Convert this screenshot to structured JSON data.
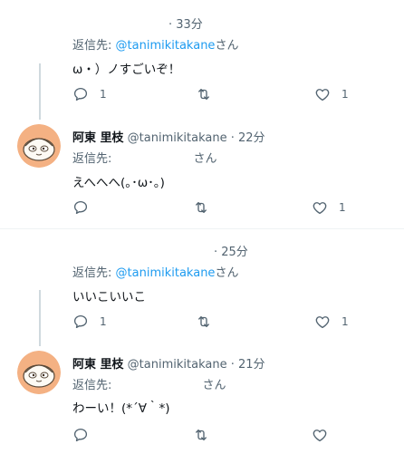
{
  "tweets": [
    {
      "time": "· 33分",
      "reply_label": "返信先:",
      "reply_handle": "@tanimikitakane",
      "reply_suffix": "さん",
      "text": "ω・）ノすごいぞ！",
      "replies": "1",
      "retweets": "",
      "likes": "1"
    },
    {
      "author_name": "阿東 里枝",
      "author_handle": "@tanimikitakane",
      "time": "· 22分",
      "reply_label": "返信先:",
      "reply_suffix": "さん",
      "text": "えへへへ(｡･ω･｡)",
      "replies": "",
      "retweets": "",
      "likes": "1"
    },
    {
      "time": "· 25分",
      "reply_label": "返信先:",
      "reply_handle": "@tanimikitakane",
      "reply_suffix": "さん",
      "text": "いいこいいこ",
      "replies": "1",
      "retweets": "",
      "likes": "1"
    },
    {
      "author_name": "阿東 里枝",
      "author_handle": "@tanimikitakane",
      "time": "· 21分",
      "reply_label": "返信先:",
      "reply_suffix": "さん",
      "text": "わーい！(*´∀｀*)",
      "replies": "",
      "retweets": "",
      "likes": ""
    }
  ],
  "icons": [
    "reply-icon",
    "retweet-icon",
    "like-icon"
  ],
  "colors": {
    "link": "#1d9bf0",
    "muted": "#536471",
    "thread_line": "#cfd9de",
    "avatar_bg": "#f4b183"
  }
}
